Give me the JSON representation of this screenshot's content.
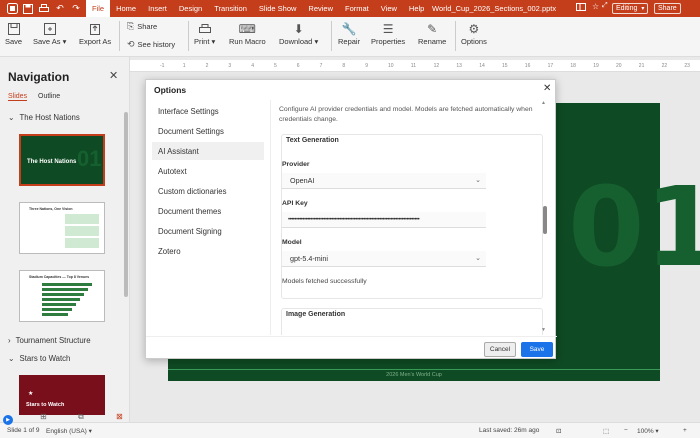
{
  "titlebar": {
    "menu": [
      "File",
      "Home",
      "Insert",
      "Design",
      "Transition",
      "Slide Show",
      "Review",
      "Format",
      "View",
      "Help"
    ],
    "document_title": "World_Cup_2026_Sections_002.pptx",
    "mode": "Editing",
    "share": "Share"
  },
  "ribbon": {
    "save": "Save",
    "save_as": "Save As",
    "export_as": "Export As",
    "share": "Share",
    "see_history": "See history",
    "print": "Print",
    "run_macro": "Run Macro",
    "download": "Download",
    "repair": "Repair",
    "properties": "Properties",
    "rename": "Rename",
    "options": "Options"
  },
  "navigation": {
    "title": "Navigation",
    "tabs": [
      "Slides",
      "Outline"
    ],
    "sections": [
      "The Host Nations",
      "Tournament Structure",
      "Stars to Watch"
    ],
    "thumb1_title": "The Host Nations",
    "thumb2_title": "Three Nations, One Vision",
    "thumb3_title": "Stadium Capacities — Top 8 Venues",
    "thumb4_title": "Stars to Watch"
  },
  "ruler": {
    "ticks": [
      "-1",
      "1",
      "2",
      "3",
      "4",
      "5",
      "6",
      "7",
      "8",
      "9",
      "10",
      "11",
      "12",
      "13",
      "14",
      "15",
      "16",
      "17",
      "18",
      "19",
      "20",
      "21",
      "22",
      "23"
    ]
  },
  "slide": {
    "big_number": "01",
    "footer": "2026 Men's World Cup"
  },
  "dialog": {
    "title": "Options",
    "sidebar": [
      "Interface Settings",
      "Document Settings",
      "AI Assistant",
      "Autotext",
      "Custom dictionaries",
      "Document themes",
      "Document Signing",
      "Zotero"
    ],
    "description": "Configure AI provider credentials and model. Models are fetched automatically when credentials change.",
    "text_gen_title": "Text Generation",
    "provider_label": "Provider",
    "provider_value": "OpenAI",
    "api_key_label": "API Key",
    "api_key_value": "••••••••••••••••••••••••••••••••••••••••••••••••••••••••••••••••••••••••••••••••••",
    "model_label": "Model",
    "model_value": "gpt-5.4-mini",
    "status": "Models fetched successfully",
    "image_gen_title": "Image Generation",
    "cancel": "Cancel",
    "save": "Save"
  },
  "statusbar": {
    "slide_of": "Slide 1 of 9",
    "language": "English (USA)",
    "last_saved": "Last saved: 26m ago",
    "zoom": "100%"
  },
  "colors": {
    "accent": "#c43e1c",
    "slide_green": "#0e4a23",
    "primary_button": "#1a73e8"
  }
}
